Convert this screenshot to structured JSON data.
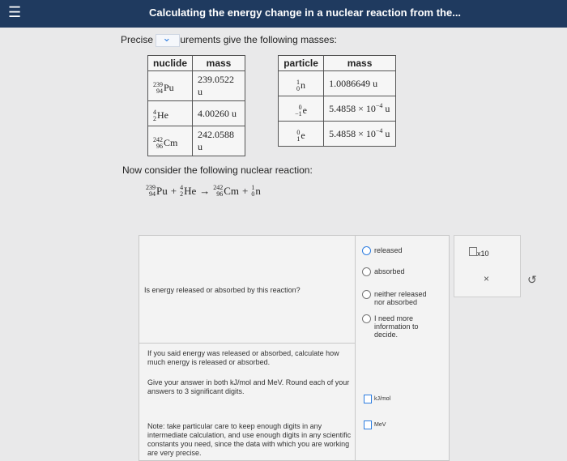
{
  "header": {
    "menu_icon": "hamburger-icon",
    "title": "Calculating the energy change in a nuclear reaction from the..."
  },
  "intro": {
    "text_start": "Precise",
    "text_end": "urements give the following masses:"
  },
  "nuclide_table": {
    "headers": [
      "nuclide",
      "mass"
    ],
    "rows": [
      {
        "mass_number": "239",
        "atomic_number": "94",
        "symbol": "Pu",
        "mass": "239.0522 u"
      },
      {
        "mass_number": "4",
        "atomic_number": "2",
        "symbol": "He",
        "mass": "4.00260 u"
      },
      {
        "mass_number": "242",
        "atomic_number": "96",
        "symbol": "Cm",
        "mass": "242.0588 u"
      }
    ]
  },
  "particle_table": {
    "headers": [
      "particle",
      "mass"
    ],
    "rows": [
      {
        "mass_number": "1",
        "atomic_number": "0",
        "symbol": "n",
        "mass": "1.0086649 u"
      },
      {
        "mass_number": "0",
        "atomic_number": "−1",
        "symbol": "e",
        "mass_base": "5.4858 × 10",
        "exp": "−4",
        "unit": "u"
      },
      {
        "mass_number": "0",
        "atomic_number": "1",
        "symbol": "e",
        "mass_base": "5.4858 × 10",
        "exp": "−4",
        "unit": "u"
      }
    ]
  },
  "reaction": {
    "intro": "Now consider the following nuclear reaction:",
    "r1": {
      "a": "239",
      "z": "94",
      "s": "Pu"
    },
    "plus1": "+",
    "r2": {
      "a": "4",
      "z": "2",
      "s": "He"
    },
    "arrow": "→",
    "p1": {
      "a": "242",
      "z": "96",
      "s": "Cm"
    },
    "plus2": "+",
    "p2": {
      "a": "1",
      "z": "0",
      "s": "n"
    }
  },
  "question1": {
    "prompt": "Is energy released or absorbed by this reaction?",
    "options": [
      "released",
      "absorbed",
      "neither released nor absorbed",
      "I need more information to decide."
    ],
    "selected": 0
  },
  "question2": {
    "prompt": "If you said energy was released or absorbed, calculate how much energy is released or absorbed.",
    "instructions": "Give your answer in both kJ/mol and MeV. Round each of your answers to 3 significant digits.",
    "note": "Note: take particular care to keep enough digits in any intermediate calculation, and use enough digits in any scientific constants you need, since the data with which you are working are very precise.",
    "unit1": "kJ/mol",
    "unit2": "MeV"
  },
  "tools": {
    "exponent_label": "x10",
    "clear": "×",
    "undo": "↺"
  },
  "colors": {
    "header_bg": "#1f3a5f",
    "accent": "#2d7de0"
  }
}
